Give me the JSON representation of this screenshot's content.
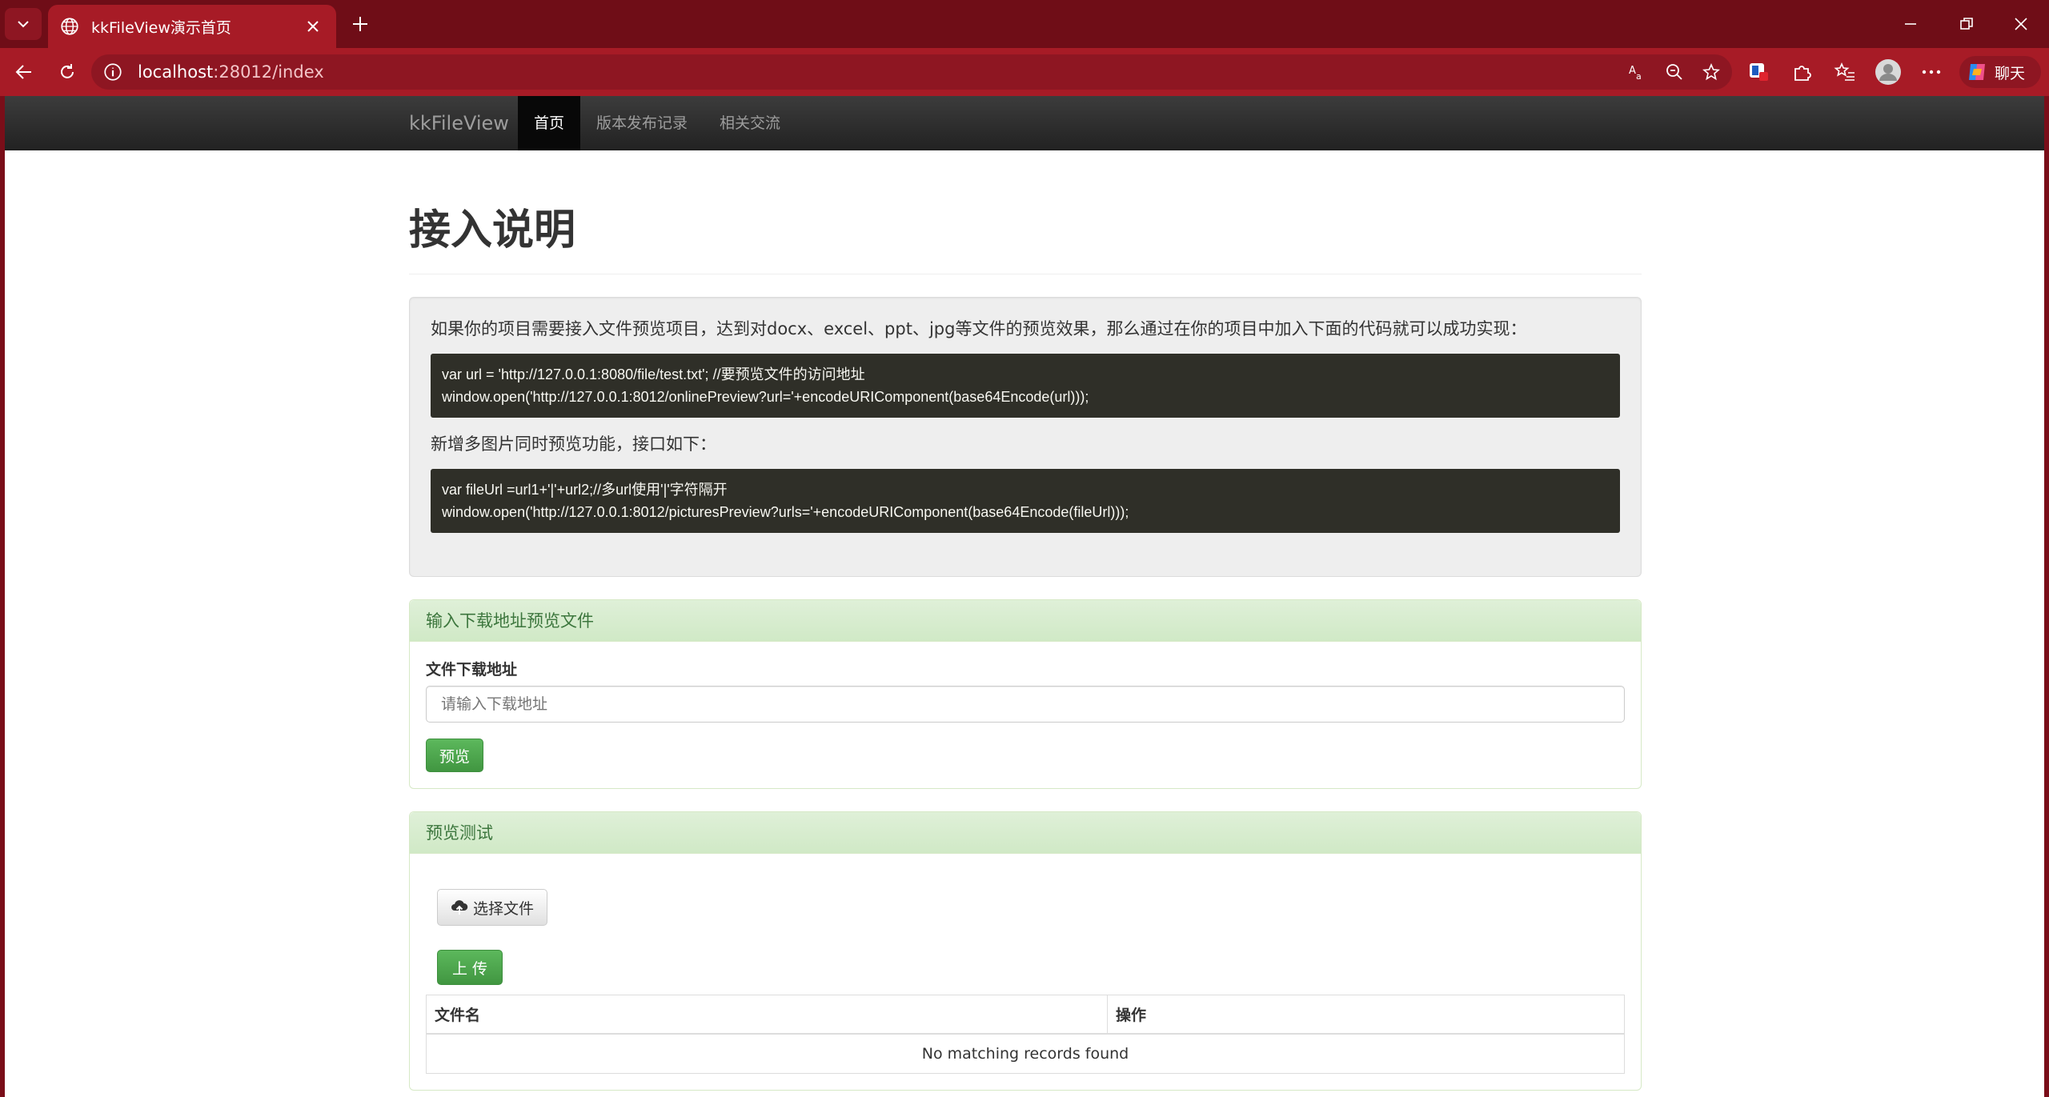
{
  "browser": {
    "tab_title": "kkFileView演示首页",
    "url_host": "localhost",
    "url_rest": ":28012/index",
    "copilot_label": "聊天"
  },
  "nav": {
    "brand": "kkFileView",
    "items": [
      {
        "label": "首页",
        "active": true
      },
      {
        "label": "版本发布记录",
        "active": false
      },
      {
        "label": "相关交流",
        "active": false
      }
    ]
  },
  "main": {
    "title": "接入说明",
    "intro": "如果你的项目需要接入文件预览项目，达到对docx、excel、ppt、jpg等文件的预览效果，那么通过在你的项目中加入下面的代码就可以成功实现：",
    "code1_line1": "var url = 'http://127.0.0.1:8080/file/test.txt'; //要预览文件的访问地址",
    "code1_line2": "window.open('http://127.0.0.1:8012/onlinePreview?url='+encodeURIComponent(base64Encode(url)));",
    "multi_intro": "新增多图片同时预览功能，接口如下：",
    "code2_line1": "var fileUrl =url1+'|'+url2;//多url使用'|'字符隔开",
    "code2_line2": "window.open('http://127.0.0.1:8012/picturesPreview?urls='+encodeURIComponent(base64Encode(fileUrl)));"
  },
  "download_panel": {
    "heading": "输入下载地址预览文件",
    "field_label": "文件下载地址",
    "placeholder": "请输入下载地址",
    "preview_button": "预览"
  },
  "test_panel": {
    "heading": "预览测试",
    "choose_button": "选择文件",
    "upload_button": "上 传",
    "columns": [
      "文件名",
      "操作"
    ],
    "empty_text": "No matching records found"
  },
  "colors": {
    "chrome": "#a71b26",
    "navbar": "#222222",
    "success": "#5cb85c"
  }
}
